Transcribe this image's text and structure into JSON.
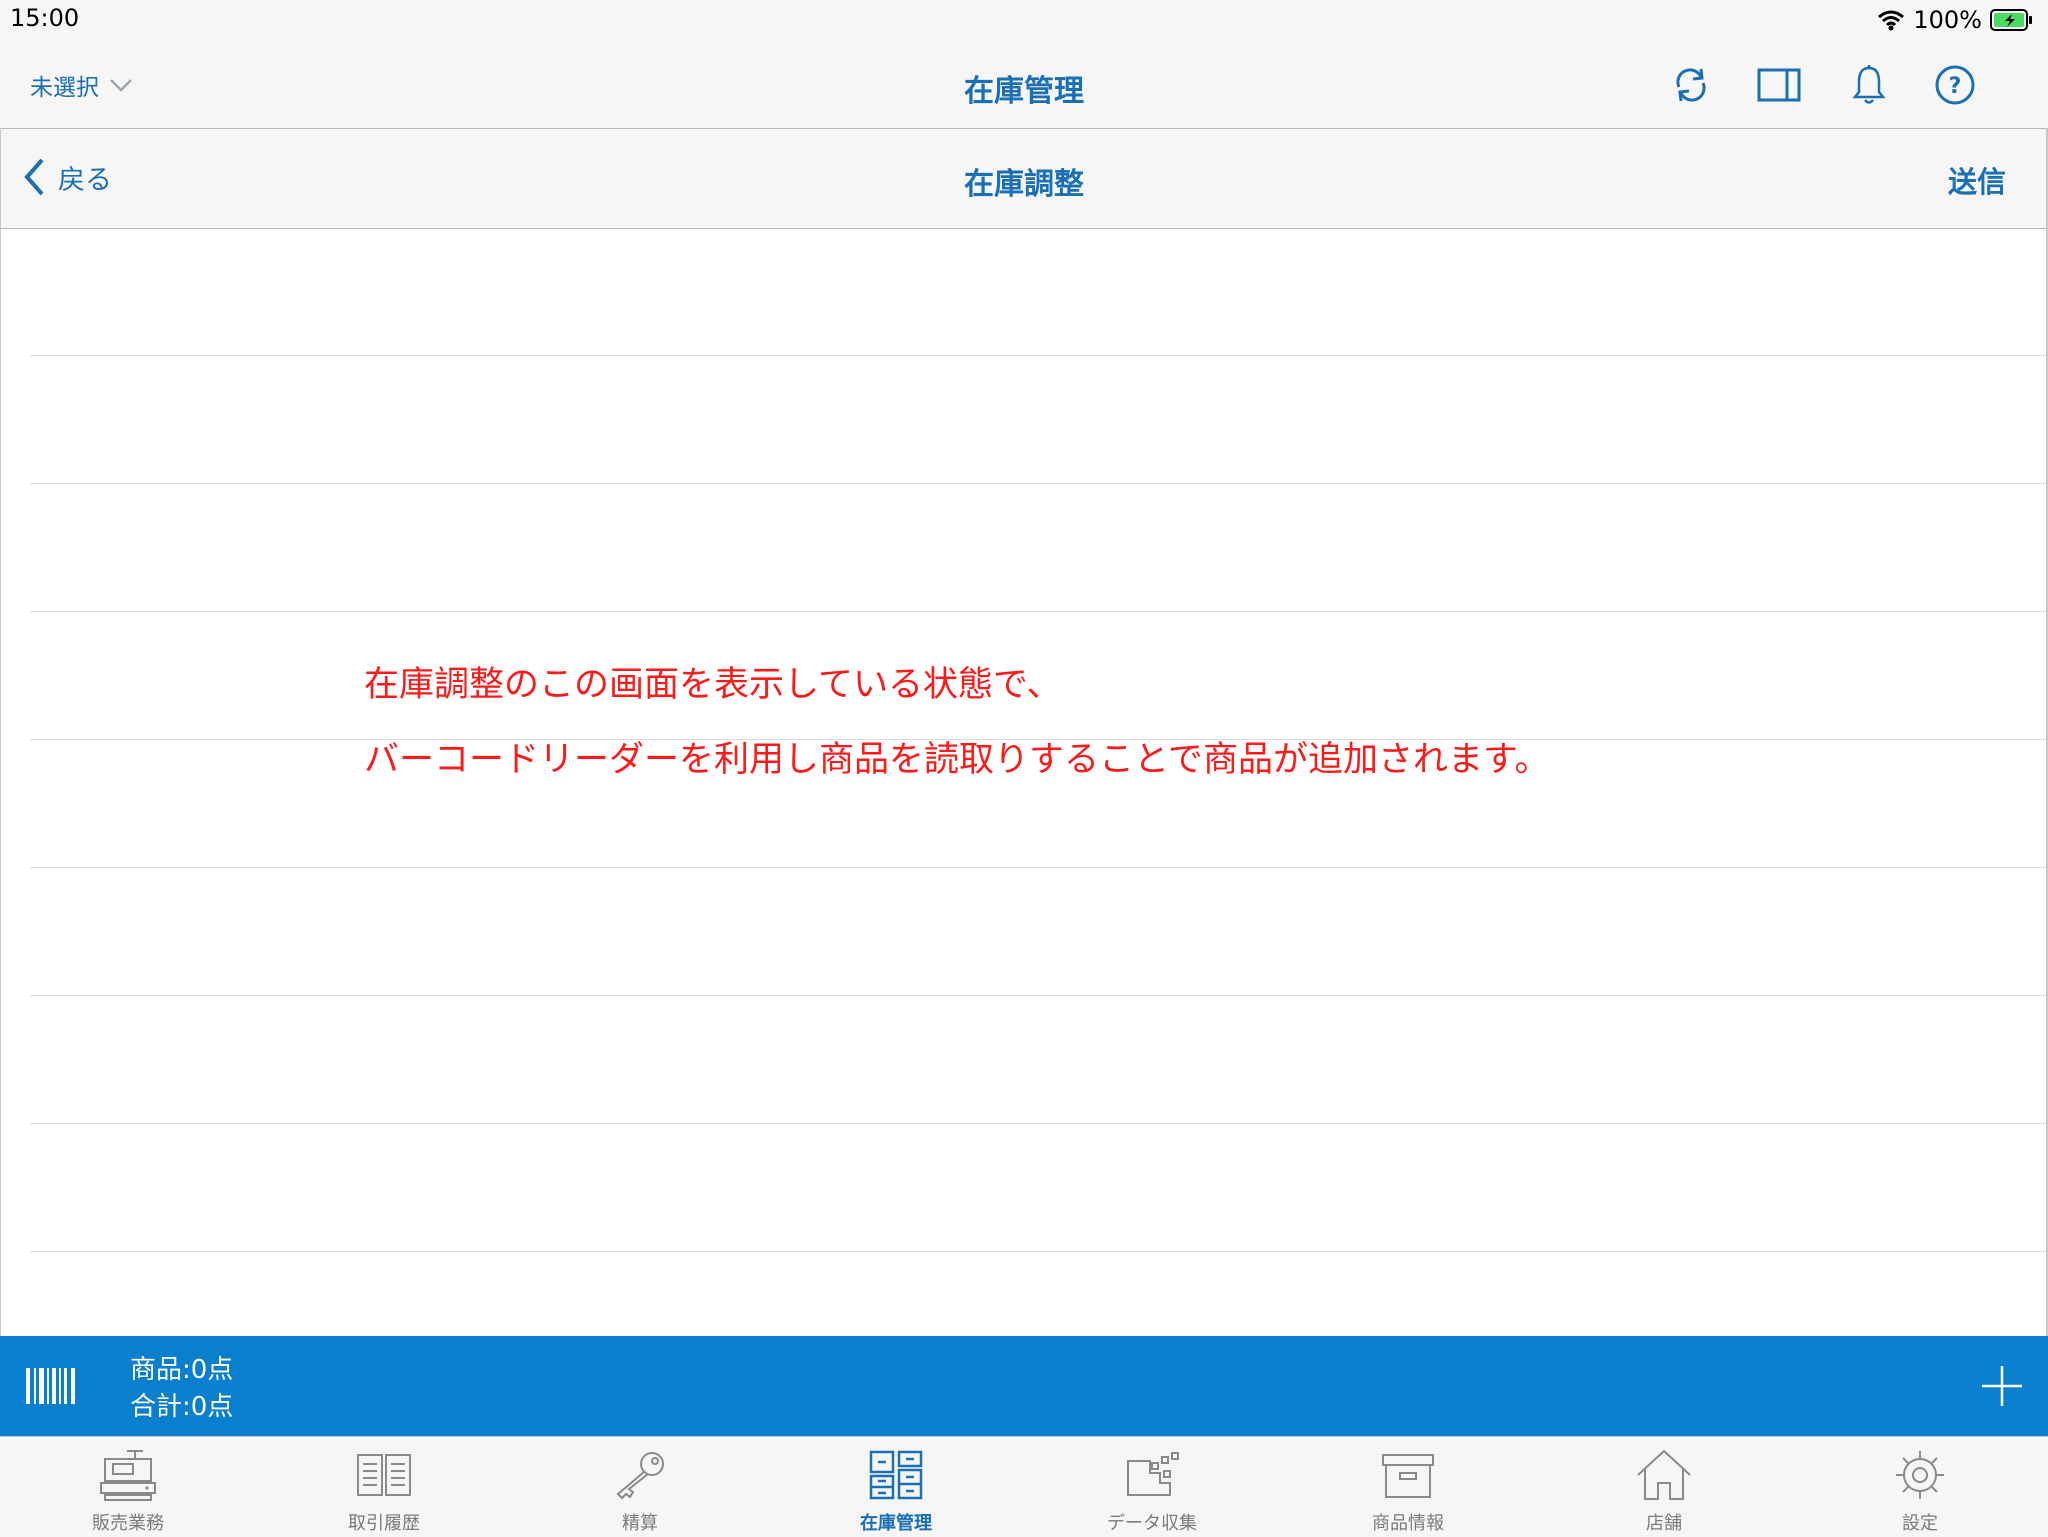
{
  "status_bar": {
    "time": "15:00",
    "battery": "100%"
  },
  "header": {
    "store_selector": "未選択",
    "title": "在庫管理",
    "icons": [
      "sync-icon",
      "split-view-icon",
      "bell-icon",
      "help-icon"
    ]
  },
  "subheader": {
    "back_label": "戻る",
    "title": "在庫調整",
    "send_label": "送信"
  },
  "note": {
    "line1": "在庫調整のこの画面を表示している状態で、",
    "line2": "バーコードリーダーを利用し商品を読取りすることで商品が追加されます。"
  },
  "action_bar": {
    "items_count": "商品:0点",
    "total_count": "合計:0点"
  },
  "tabs": [
    {
      "label": "販売業務",
      "icon": "register-icon"
    },
    {
      "label": "取引履歴",
      "icon": "book-icon"
    },
    {
      "label": "精算",
      "icon": "key-icon"
    },
    {
      "label": "在庫管理",
      "icon": "inventory-icon",
      "active": true
    },
    {
      "label": "データ収集",
      "icon": "data-collection-icon"
    },
    {
      "label": "商品情報",
      "icon": "box-icon"
    },
    {
      "label": "店舗",
      "icon": "home-icon"
    },
    {
      "label": "設定",
      "icon": "gear-icon"
    }
  ],
  "colors": {
    "accent": "#1a6fb5",
    "action_bar": "#0a7fce",
    "note": "#ff1a1a",
    "inactive": "#8a8a8a"
  }
}
